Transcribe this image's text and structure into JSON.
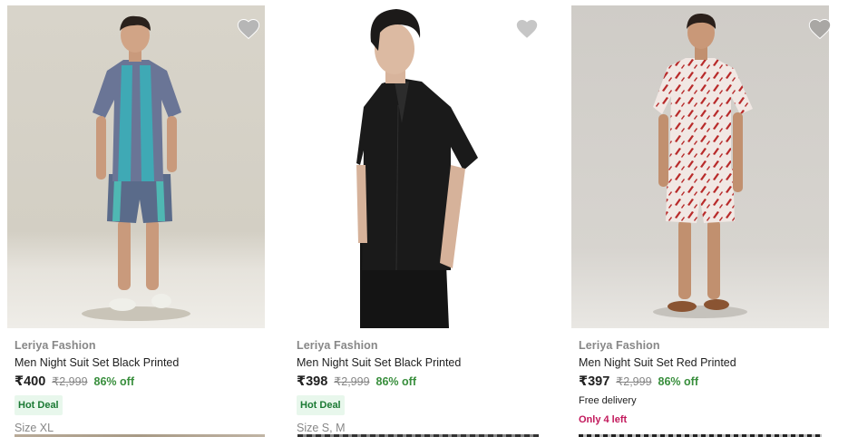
{
  "products": [
    {
      "brand": "Leriya Fashion",
      "title": "Men Night Suit Set Black Printed",
      "price": "₹400",
      "mrp": "₹2,999",
      "discount": "86% off",
      "badge": "Hot Deal",
      "size": "Size XL",
      "image_icon": "model-printed-shirt-shorts",
      "wishlist_icon": "heart-icon"
    },
    {
      "brand": "Leriya Fashion",
      "title": "Men Night Suit Set Black Printed",
      "price": "₹398",
      "mrp": "₹2,999",
      "discount": "86% off",
      "badge": "Hot Deal",
      "size": "Size S, M",
      "image_icon": "model-black-shirt-shorts",
      "wishlist_icon": "heart-icon"
    },
    {
      "brand": "Leriya Fashion",
      "title": "Men Night Suit Set Red Printed",
      "price": "₹397",
      "mrp": "₹2,999",
      "discount": "86% off",
      "delivery": "Free delivery",
      "stock": "Only 4 left",
      "image_icon": "model-red-printed-shirt-shorts",
      "wishlist_icon": "heart-icon"
    }
  ],
  "colors": {
    "discount_green": "#388e3c",
    "hot_deal_bg": "#e8f7ec",
    "stock_pink": "#c2185b",
    "muted_gray": "#878787"
  }
}
